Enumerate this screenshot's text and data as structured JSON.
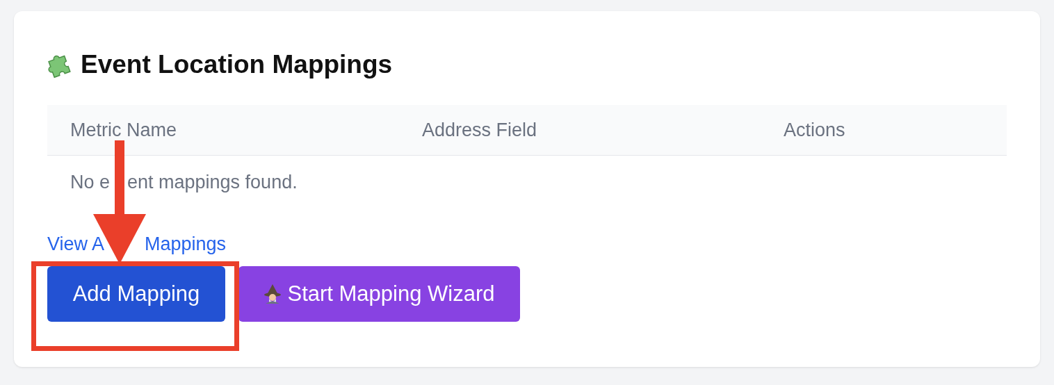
{
  "card": {
    "title": "Event Location Mappings"
  },
  "table": {
    "columns": [
      "Metric Name",
      "Address Field",
      "Actions"
    ],
    "empty_message": [
      "No e",
      "ent mappings found."
    ]
  },
  "link": [
    "View A",
    "Mappings"
  ],
  "buttons": [
    {
      "label": "Add Mapping",
      "kind": "primary"
    },
    {
      "label": "Start Mapping Wizard",
      "kind": "wizard"
    }
  ]
}
